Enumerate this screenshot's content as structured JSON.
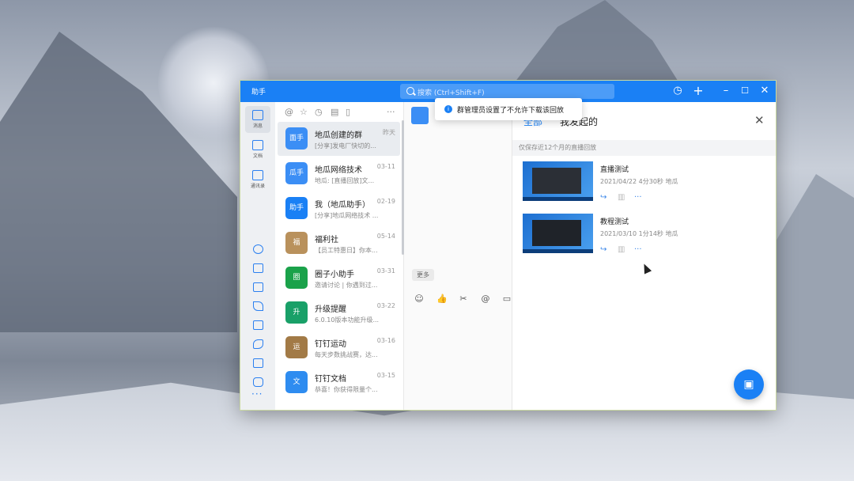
{
  "app": {
    "title": "助手"
  },
  "search": {
    "placeholder": "搜索 (Ctrl+Shift+F)"
  },
  "toast": {
    "text": "群管理员设置了不允许下载该回放"
  },
  "rail": {
    "items": [
      {
        "label": "消息"
      },
      {
        "label": "文档"
      },
      {
        "label": "通讯录"
      }
    ],
    "more": "···"
  },
  "chatlist": {
    "more": "···",
    "chats": [
      {
        "name": "地瓜创建的群",
        "time": "昨天",
        "preview": "[分享]发电厂快切的...",
        "avatar": "面手",
        "color": "#3b8ef5"
      },
      {
        "name": "地瓜网络技术",
        "time": "03-11",
        "preview": "地瓜: [直播回放]文...",
        "avatar": "瓜手",
        "color": "#3b8ef5"
      },
      {
        "name": "我（地瓜助手）",
        "time": "02-19",
        "preview": "[分享]地瓜网络技术 ...",
        "avatar": "助手",
        "color": "#1a80f5"
      },
      {
        "name": "福利社",
        "time": "05-14",
        "preview": "【员工特惠日】你本...",
        "avatar": "福",
        "color": "#b9915c"
      },
      {
        "name": "圈子小助手",
        "time": "03-31",
        "preview": "邀请讨论 | 你遇到过...",
        "avatar": "圈",
        "color": "#1aa24a"
      },
      {
        "name": "升级提醒",
        "time": "03-22",
        "preview": "6.0.10版本功能升级...",
        "avatar": "升",
        "color": "#19a068"
      },
      {
        "name": "钉钉运动",
        "time": "03-16",
        "preview": "每天步数挑战赛，达...",
        "avatar": "运",
        "color": "#a27a46"
      },
      {
        "name": "钉钉文档",
        "time": "03-15",
        "preview": "恭喜！你获得限量个...",
        "avatar": "文",
        "color": "#2e8cf0"
      }
    ]
  },
  "convo": {
    "more_label": "更多"
  },
  "replay": {
    "tabs": [
      {
        "label": "全部"
      },
      {
        "label": "我发起的"
      }
    ],
    "notice": "仅保存近12个月的直播回放",
    "items": [
      {
        "title": "直播测试",
        "meta": "2021/04/22 4分30秒 地瓜"
      },
      {
        "title": "教程测试",
        "meta": "2021/03/10 1分14秒 地瓜"
      }
    ]
  },
  "colors": {
    "accent": "#1a80f5"
  }
}
